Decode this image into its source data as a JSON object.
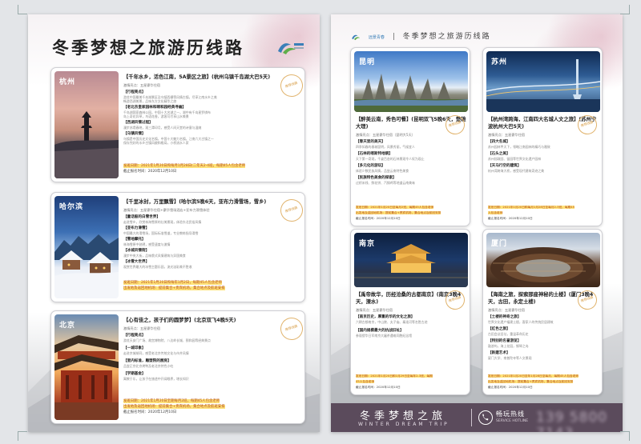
{
  "page1": {
    "title": "冬季梦想之旅游历线路",
    "cards": [
      {
        "tag": "杭州",
        "title": "【千年水乡，活色江南，5A景区之旅】(杭州乌镇千岛湖大巴5天)",
        "sub": "激情亮点：五星豪华住宿",
        "sections": [
          {
            "h": "【行程亮点】",
            "lines": [
              "游览中国最美千岛湖景区及乌镇西栅等风情古镇，尽享江南水乡之美",
              "畅游西湖美景，品味东方文化精华之旅"
            ]
          },
          {
            "h": "【老北京皇家园林和颐和园经典寻幽】",
            "lines": [
              "千岛湖国家森林公园，中国十大名湖之一，湖中有千岛星罗棋布",
              "岛上奇花异草，鸟语花香，游客可尽享山水美景"
            ]
          },
          {
            "h": "【西湖风情过程】",
            "lines": [
              "漫步苏堤春晓，观三潭印月，感受人间天堂的诗意与温婉"
            ]
          },
          {
            "h": "【乌镇风情】",
            "lines": [
              "乌镇是中国历史文化名镇，中国十大魅力名镇，江南六大古镇之一",
              "保存完好的水乡古镇风貌和格局，小桥流水人家"
            ]
          }
        ],
        "dep": "发班日期：2021年1月20日和每月1月28日(二年天2-4班，每期45人包含老师",
        "dep2": "截止报名时间：2020年12月10日"
      },
      {
        "tag": "哈尔滨",
        "title": "【千里冰封，万里飘雪】(哈尔滨5晚6天，亚布力滑雪场，雪乡)",
        "sub": "激情亮点：五星豪华住宿+豪华雪场酒店+亚布力滑雪体验",
        "sections": [
          {
            "h": "【童话般的白雪世界】",
            "lines": [
              "走进雪乡，欣赏林海雪原的壮美景观，体验东北民俗风情"
            ]
          },
          {
            "h": "【亚布力滑雪】",
            "lines": [
              "中国最大的滑雪场，国际标准雪道，专业教练指导滑雪"
            ]
          },
          {
            "h": "【雪地摩托】",
            "lines": [
              "林海雪原中驰骋，感受速度与激情"
            ]
          },
          {
            "h": "【冰城风情街】",
            "lines": [
              "漫步中央大街，品味俄式风情建筑与异国美食"
            ]
          },
          {
            "h": "【冰雪大世界】",
            "lines": [
              "观赏世界最大的冰雪主题乐园，流光溢彩美不胜收"
            ]
          }
        ],
        "dep": "发班日期：2021年1月20日和每年1月2日，每期45人包含老师",
        "dep2": "出发地及返回地机场：提前集合+贵宾机场，集合地点及航班安排"
      },
      {
        "tag": "北京",
        "title": "【心有佳之，孩子们的圆梦梦】(北京双飞4晚5天)",
        "sub": "激情亮点：五星豪华住宿",
        "sections": [
          {
            "h": "【行程亮点】",
            "lines": [
              "游览天安门广场、故宫博物院、八达岭长城、颐和园等经典景点"
            ]
          },
          {
            "h": "【一城印象】",
            "lines": [
              "走进京城胡同，感受老北京传统文化与市井风情"
            ]
          },
          {
            "h": "【室内标准，雕塑院的厨房】",
            "lines": [
              "品尝正宗北京烤鸭及老北京特色小吃"
            ]
          },
          {
            "h": "【学期基金】",
            "lines": [
              "寓教于乐，让孩子在旅途中开阔眼界，增长知识"
            ]
          }
        ],
        "dep": "发班日期：2021年1月20日至期每月2班，每期45人包含老师",
        "dep2": "出发地及返回地机场：提前集合+贵宾机场，集合地点及航班安排",
        "dep3": "截止报名时间：2020年12月10日"
      }
    ]
  },
  "page2": {
    "header_brand": "远景青春",
    "header_title": "冬季梦想之旅游历线路",
    "cards": [
      {
        "tag": "昆明",
        "title": "【醉美云南，秀色可餐】(昆明双飞5晚6天，楚雄大理)",
        "sub": "激情亮点：五星豪华住宿（昆明大5天）",
        "sections": [
          {
            "h": "【春天里的美天】",
            "lines": [
              "四季如春的春城昆明，风景秀丽，气候宜人"
            ]
          },
          {
            "h": "【石林的喀斯特地貌】",
            "lines": [
              "天下第一奇观，千姿百态的石林景观令人叹为观止"
            ]
          },
          {
            "h": "【多元化的游玩】",
            "lines": [
              "体验少数民族风情，品尝云南特色美食"
            ]
          },
          {
            "h": "【民族特色美食的探索】",
            "lines": [
              "过桥米线、鲜花饼、汽锅鸡等地道云南美味"
            ]
          }
        ],
        "dep": "发班日期：2021年1月20日至每月2班，每期45人包含老师",
        "dep2": "出发地及返回地机场：提前集合+贵宾机场，集合地点及航班安排",
        "dep3": "截止报名时间：2020年12月10日"
      },
      {
        "tag": "苏州",
        "title": "【杭州湾跨海，江南四大名城人文之旅】(苏州宁波杭州大巴5天)",
        "sub": "激情亮点：五星豪华住宿",
        "sections": [
          {
            "h": "【四大名城】",
            "lines": [
              "苏州园林甲天下，领略江南园林的精巧与雅致"
            ]
          },
          {
            "h": "【石头之美】",
            "lines": [
              "苏州拙政园、留园等世界文化遗产园林"
            ]
          },
          {
            "h": "【天马行空的建筑】",
            "lines": [
              "杭州湾跨海大桥，感受现代建筑奇迹之美"
            ]
          }
        ],
        "dep": "发班日期：2021年1月20日和每月1月28日至每月2-3班，每期45",
        "dep2": "人包含老师",
        "dep3": "截止报名时间：2020年12月10日"
      },
      {
        "tag": "南京",
        "title": "【禹帝故华，历经沧桑的古都南京】(南京3晚4天，溧水)",
        "sub": "激情亮点：五星豪华住宿",
        "sections": [
          {
            "h": "【南京历史，厚重的华的文化之旅】",
            "lines": [
              "六朝古都南京，中山陵、夫子庙、秦淮河等名胜古迹"
            ]
          },
          {
            "h": "【国内规模最大的抗战旧址】",
            "lines": [
              "参观侵华日军南京大屠杀遇难同胞纪念馆"
            ]
          }
        ],
        "dep": "发班日期：2021年1月20日和1月29日至每年2-3班，每期",
        "dep2": "45人包含老师",
        "dep3": "截止报名时间：2020年12月10日"
      },
      {
        "tag": "厦门",
        "title": "【海南之旅，探索那座神秘的土楼】(厦门3晚4天，古田，永定土楼)",
        "sub": "激情亮点：五星豪华住宿",
        "sections": [
          {
            "h": "【土楼的神奇之旅】",
            "lines": [
              "世界文化遗产福建土楼，客家人的传统民居建筑"
            ]
          },
          {
            "h": "【红色之旅】",
            "lines": [
              "古田会议旧址，重温革命历史"
            ]
          },
          {
            "h": "【特别的名誉游览】",
            "lines": [
              "鼓浪屿，海上花园，钢琴之岛"
            ]
          },
          {
            "h": "【新建艺术】",
            "lines": [
              "厦门大学、南普陀寺等人文景观"
            ]
          }
        ],
        "dep": "发班日期：2021年1月20日至年1月28日至每月，每期45人包含老师",
        "dep2": "出发地及返回地机场：提前集合+贵宾机场，集合地点及航班安排",
        "dep3": "截止报名时间：2020年12月10日"
      }
    ],
    "footer": {
      "title": "冬季梦想之旅",
      "subtitle": "WINTER DREAM TRIP",
      "hotline": "畅玩热线",
      "hotline_sub": "SERVICE HOTLINE",
      "number": "139 5800 7143"
    }
  },
  "stamp_text": "推荐线路"
}
